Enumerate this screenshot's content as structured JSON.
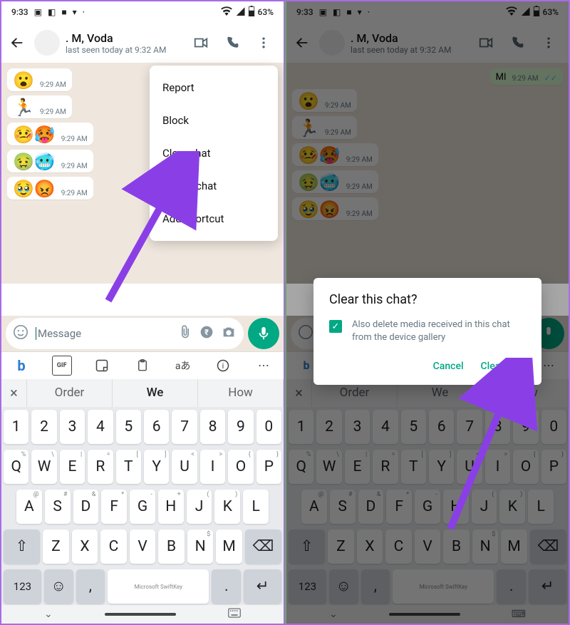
{
  "status": {
    "time": "9:33",
    "battery": "63%"
  },
  "header": {
    "contact_name": ". M, Voda",
    "last_seen": "last seen today at 9:32 AM"
  },
  "messages": [
    {
      "emoji": "😮",
      "time": "9:29 AM"
    },
    {
      "emoji": "🏃",
      "time": "9:29 AM"
    },
    {
      "emoji": "🤒🥵",
      "time": "9:29 AM"
    },
    {
      "emoji": "🤢🥶",
      "time": "9:29 AM"
    },
    {
      "emoji": "🥹😡",
      "time": "9:29 AM"
    }
  ],
  "out_msg": {
    "text": "MI",
    "time": "9:29 AM"
  },
  "input": {
    "placeholder": "Message"
  },
  "overflow_menu": {
    "items": [
      "Report",
      "Block",
      "Clear chat",
      "Export chat",
      "Add shortcut"
    ]
  },
  "dialog": {
    "title": "Clear this chat?",
    "checkbox_label": "Also delete media received in this chat from the device gallery",
    "cancel": "Cancel",
    "confirm": "Clear chat"
  },
  "keyboard": {
    "suggestions": [
      "Order",
      "We",
      "How"
    ],
    "row1": [
      "1",
      "2",
      "3",
      "4",
      "5",
      "6",
      "7",
      "8",
      "9",
      "0"
    ],
    "row2": [
      "Q",
      "W",
      "E",
      "R",
      "T",
      "Y",
      "U",
      "I",
      "O",
      "P"
    ],
    "row2_alt": [
      "%",
      "\\",
      "|",
      "=",
      "[",
      "]",
      "<",
      ">",
      "{",
      "}"
    ],
    "row3": [
      "A",
      "S",
      "D",
      "F",
      "G",
      "H",
      "J",
      "K",
      "L"
    ],
    "row3_alt": [
      "@",
      "#",
      "&",
      "*",
      "-",
      "+",
      "(",
      ")",
      ""
    ],
    "row4": [
      "Z",
      "X",
      "C",
      "V",
      "B",
      "N",
      "M"
    ],
    "row4_alt": [
      "",
      "",
      "",
      "",
      "",
      "$",
      ""
    ],
    "brand": "Microsoft SwiftKey",
    "num_key": "123"
  }
}
